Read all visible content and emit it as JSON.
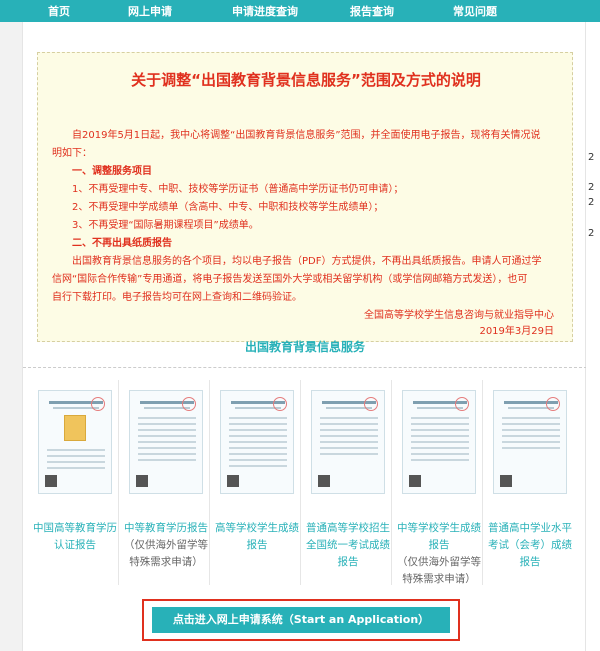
{
  "nav": {
    "items": [
      "首页",
      "网上申请",
      "申请进度查询",
      "报告查询",
      "常见问题"
    ]
  },
  "notice": {
    "title": "关于调整“出国教育背景信息服务”范围及方式的说明",
    "intro1": "自2019年5月1日起，我中心将调整“出国教育背景信息服务”范围，并全面使用电子报告，现将有关情况说",
    "intro2": "明如下：",
    "section1": "一、调整服务项目",
    "item1": "1、不再受理中专、中职、技校等学历证书（普通高中学历证书仍可申请）；",
    "item2": "2、不再受理中学成绩单（含高中、中专、中职和技校等学生成绩单）；",
    "item3": "3、不再受理“国际暑期课程项目”成绩单。",
    "section2": "二、不再出具纸质报告",
    "para1": "出国教育背景信息服务的各个项目，均以电子报告（PDF）方式提供，不再出具纸质报告。申请人可通过学",
    "para2": "信网“国际合作传输”专用通道，将电子报告发送至国外大学或相关留学机构（或学信网邮箱方式发送），也可",
    "para3": "自行下载打印。电子报告均可在网上查询和二维码验证。",
    "signature": "全国高等学校学生信息咨询与就业指导中心",
    "date": "2019年3月29日"
  },
  "service": {
    "title": "出国教育背景信息服务",
    "cards": [
      {
        "label": "中国高等教育学历认证报告",
        "note": ""
      },
      {
        "label": "中等教育学历报告",
        "note": "（仅供海外留学等特殊需求申请）"
      },
      {
        "label": "高等学校学生成绩报告",
        "note": ""
      },
      {
        "label": "普通高等学校招生全国统一考试成绩报告",
        "note": ""
      },
      {
        "label": "中等学校学生成绩报告",
        "note": "（仅供海外留学等特殊需求申请）"
      },
      {
        "label": "普通高中学业水平考试（会考）成绩报告",
        "note": ""
      }
    ]
  },
  "apply": {
    "label": "点击进入网上申请系统（Start an Application）"
  },
  "sidebar": {
    "chars": [
      "2",
      "2",
      "2",
      "2"
    ]
  },
  "colors": {
    "accent": "#28b1b8",
    "notice_text": "#e0301e",
    "notice_bg": "#fdfce5",
    "highlight_frame": "#e0301e"
  }
}
